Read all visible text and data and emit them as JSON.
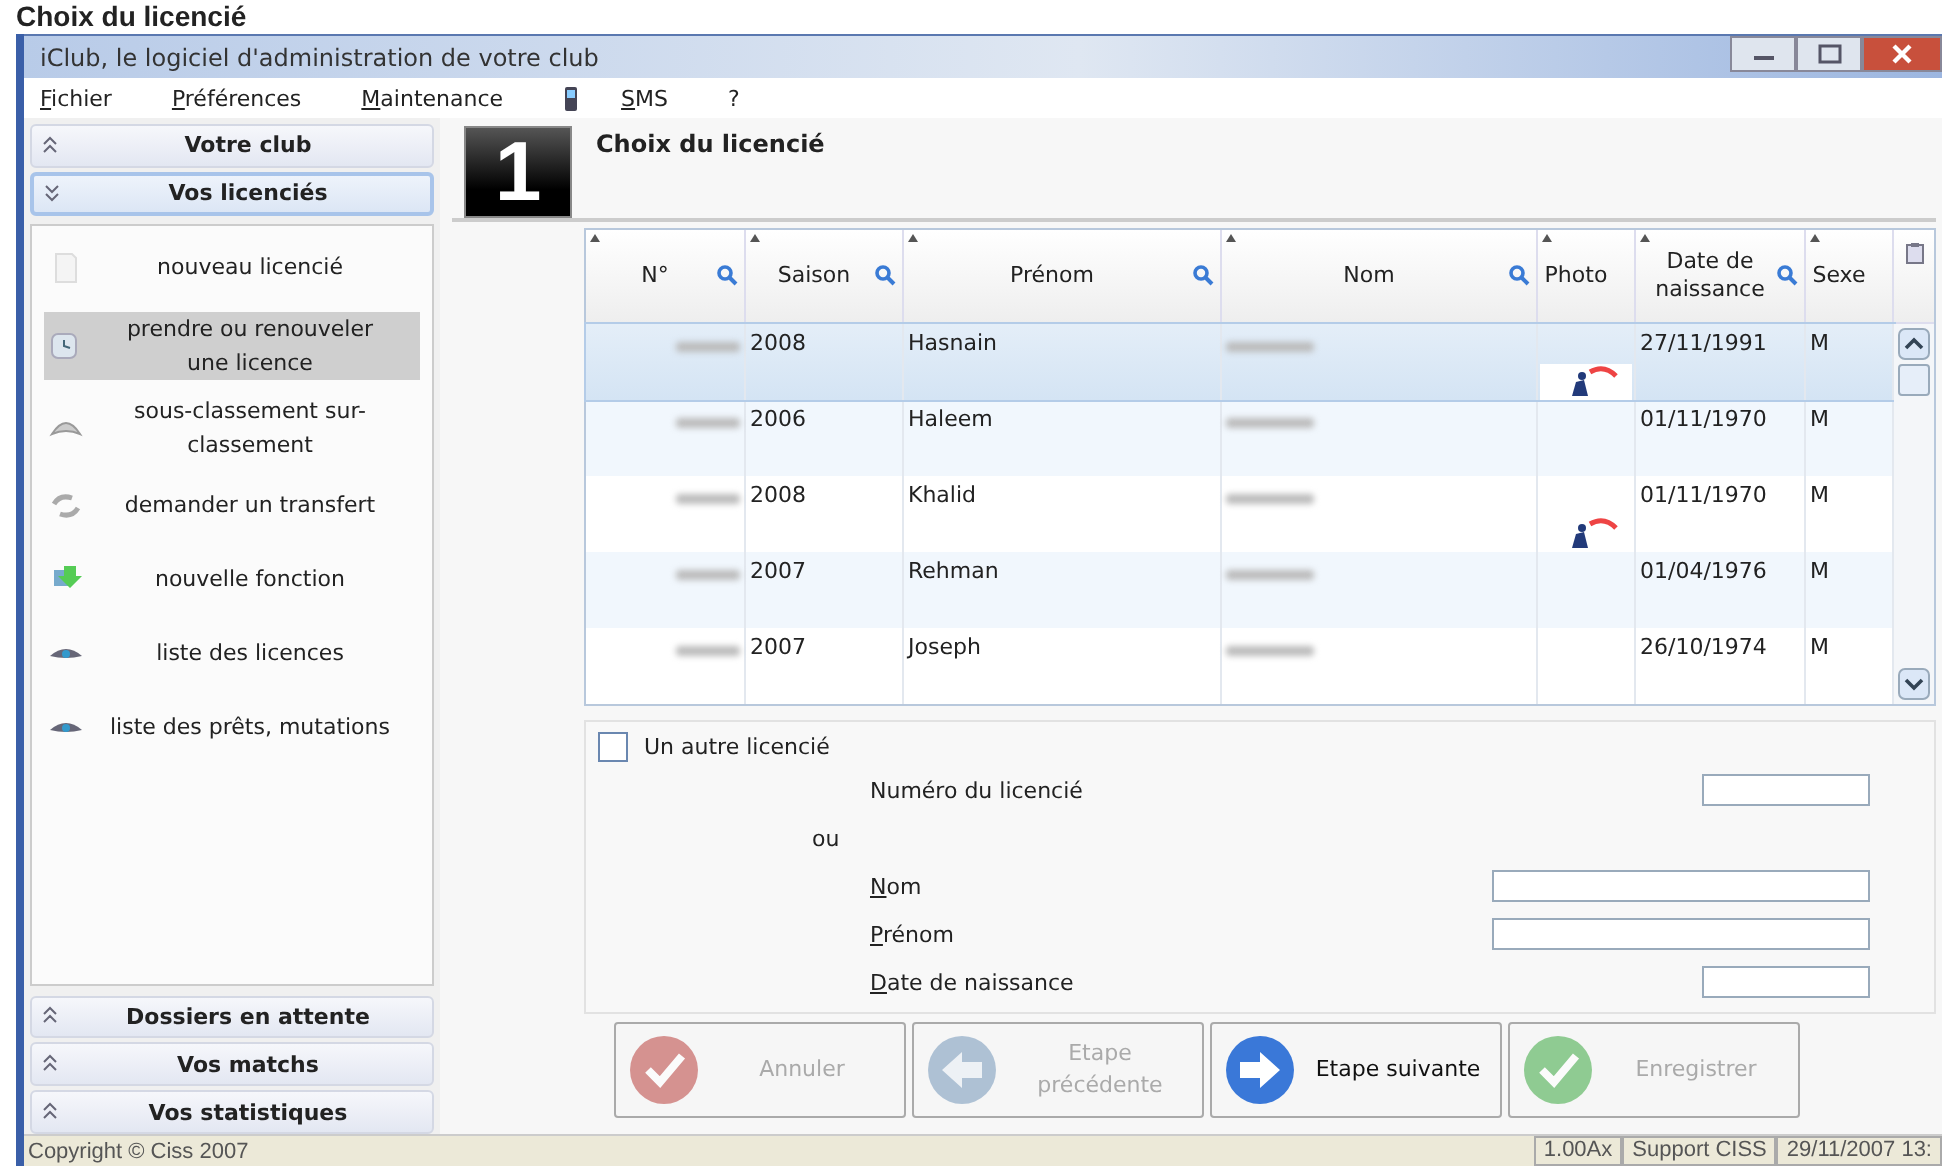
{
  "caption": "Choix du licencié",
  "window": {
    "title": "iClub, le logiciel d'administration de votre club"
  },
  "menu": [
    {
      "label": "Fichier",
      "kind": "text"
    },
    {
      "label": "Préférences",
      "kind": "text"
    },
    {
      "label": "Maintenance",
      "kind": "text"
    },
    {
      "kind": "phone"
    },
    {
      "label": "SMS",
      "kind": "text"
    },
    {
      "label": "?",
      "kind": "text"
    }
  ],
  "sidebar": {
    "top_sections": [
      {
        "label": "Votre club",
        "expanded": false
      },
      {
        "label": "Vos licenciés",
        "expanded": true
      }
    ],
    "items": [
      {
        "label": "nouveau licencié",
        "selected": false
      },
      {
        "label": "prendre ou renouveler une licence",
        "selected": true
      },
      {
        "label": "sous-classement sur-classement",
        "selected": false
      },
      {
        "label": "demander un transfert",
        "selected": false
      },
      {
        "label": "nouvelle fonction",
        "selected": false
      },
      {
        "label": "liste des licences",
        "selected": false
      },
      {
        "label": "liste des prêts, mutations",
        "selected": false
      }
    ],
    "bottom_sections": [
      {
        "label": "Dossiers en attente",
        "expanded": false
      },
      {
        "label": "Vos matchs",
        "expanded": false
      },
      {
        "label": "Vos statistiques",
        "expanded": false
      }
    ]
  },
  "step": {
    "number": "1",
    "title": "Choix du licencié"
  },
  "table": {
    "columns": [
      {
        "label": "N°",
        "searchable": true
      },
      {
        "label": "Saison",
        "searchable": true
      },
      {
        "label": "Prénom",
        "searchable": true
      },
      {
        "label": "Nom",
        "searchable": true
      },
      {
        "label": "Photo",
        "searchable": false
      },
      {
        "label": "Date de naissance",
        "searchable": true
      },
      {
        "label": "Sexe",
        "searchable": false
      }
    ],
    "rows": [
      {
        "redacted": true,
        "saison": "2008",
        "prenom": "Hasnain",
        "photo": true,
        "naissance": "27/11/1991",
        "sexe": "M",
        "selected": true
      },
      {
        "redacted": true,
        "saison": "2006",
        "prenom": "Haleem",
        "photo": false,
        "naissance": "01/11/1970",
        "sexe": "M",
        "selected": false
      },
      {
        "redacted": true,
        "saison": "2008",
        "prenom": "Khalid",
        "photo": true,
        "naissance": "01/11/1970",
        "sexe": "M",
        "selected": false
      },
      {
        "redacted": true,
        "saison": "2007",
        "prenom": "Rehman",
        "photo": false,
        "naissance": "01/04/1976",
        "sexe": "M",
        "selected": false
      },
      {
        "redacted": true,
        "saison": "2007",
        "prenom": "Joseph",
        "photo": false,
        "naissance": "26/10/1974",
        "sexe": "M",
        "selected": false
      }
    ]
  },
  "other": {
    "label": "Un autre licencié",
    "checked": false,
    "fields": [
      {
        "kind": "short",
        "label": "Numéro du licencié",
        "mnemonic": false
      },
      {
        "kind": "separator",
        "label": "ou"
      },
      {
        "kind": "long",
        "label": "Nom",
        "mnemonic": true
      },
      {
        "kind": "long",
        "label": "Prénom",
        "mnemonic": true
      },
      {
        "kind": "short",
        "label": "Date de naissance",
        "mnemonic": true
      }
    ]
  },
  "buttons": [
    {
      "kind": "cancel",
      "label": "Annuler",
      "enabled": false
    },
    {
      "kind": "back",
      "label": "Etape précédente",
      "enabled": false
    },
    {
      "kind": "next",
      "label": "Etape suivante",
      "enabled": true
    },
    {
      "kind": "save",
      "label": "Enregistrer",
      "enabled": false
    }
  ],
  "status_bar": {
    "copyright": "Copyright © Ciss 2007",
    "cells": [
      "1.00Ax",
      "Support CISS",
      "29/11/2007 13:"
    ]
  }
}
